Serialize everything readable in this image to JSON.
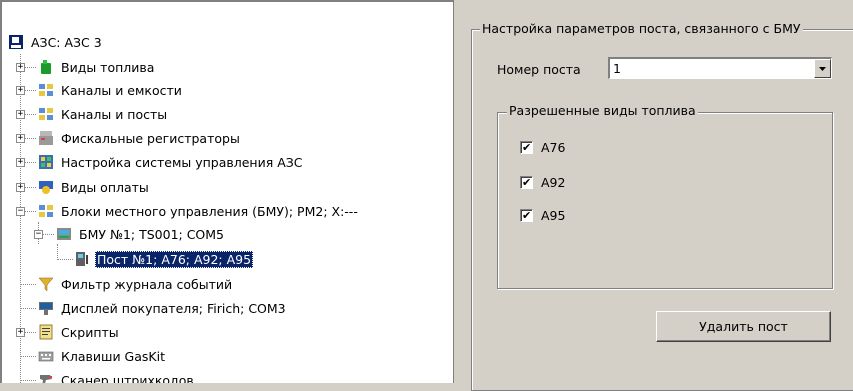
{
  "tree": {
    "root": {
      "label": "АЗС: АЗС 3",
      "icon": "fuel-station-icon"
    },
    "items": [
      {
        "label": "Виды топлива",
        "icon": "fuel-can-icon"
      },
      {
        "label": "Каналы и емкости",
        "icon": "channel-icon"
      },
      {
        "label": "Каналы и посты",
        "icon": "channel-icon"
      },
      {
        "label": "Фискальные регистраторы",
        "icon": "cash-register-icon"
      },
      {
        "label": "Настройка системы управления АЗС",
        "icon": "control-panel-icon"
      },
      {
        "label": "Виды оплаты",
        "icon": "payment-icon"
      },
      {
        "label": "Блоки местного управления (БМУ);  РМ2;  X:---",
        "icon": "channel-icon"
      },
      {
        "label": "БМУ №1; TS001; COM5",
        "icon": "terminal-icon"
      },
      {
        "label": "Пост №1; А76; А92; А95",
        "icon": "fuel-dispenser-icon"
      },
      {
        "label": "Фильтр журнала событий",
        "icon": "filter-icon"
      },
      {
        "label": "Дисплей покупателя; Firich; COM3",
        "icon": "display-icon"
      },
      {
        "label": "Скрипты",
        "icon": "script-icon"
      },
      {
        "label": "Клавиши GasKit",
        "icon": "keyboard-icon"
      },
      {
        "label": "Сканер штрихкодов",
        "icon": "barcode-scanner-icon"
      }
    ]
  },
  "panel": {
    "title": "Настройка параметров поста, связанного с БМУ",
    "post_number_label": "Номер поста",
    "post_number_value": "1",
    "fuel_group_title": "Разрешенные виды топлива",
    "fuels": [
      {
        "label": "А76",
        "checked": true
      },
      {
        "label": "А92",
        "checked": true
      },
      {
        "label": "А95",
        "checked": true
      }
    ],
    "delete_button": "Удалить пост"
  }
}
